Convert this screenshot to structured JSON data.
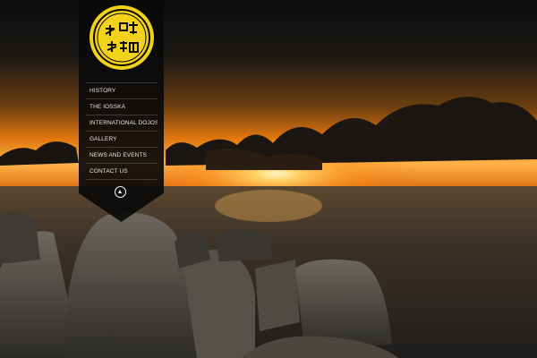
{
  "logo": {
    "icon": "dojo-emblem-icon",
    "color": "#f2d21b"
  },
  "nav": {
    "items": [
      {
        "label": "HISTORY"
      },
      {
        "label": "THE IOSSKA"
      },
      {
        "label": "INTERNATIONAL DOJOS"
      },
      {
        "label": "GALLERY"
      },
      {
        "label": "NEWS AND EVENTS"
      },
      {
        "label": "CONTACT US"
      }
    ],
    "scroll_top_icon": "arrow-up-icon"
  },
  "colors": {
    "sky_top": "#141414",
    "sunset_orange": "#ff8a1c",
    "sea": "#3b3127",
    "menu_bg": "#0a0a0a"
  }
}
